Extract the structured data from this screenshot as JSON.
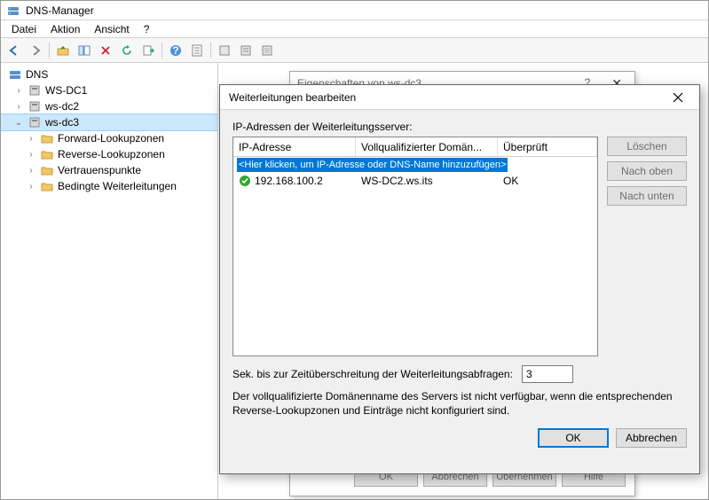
{
  "window": {
    "title": "DNS-Manager"
  },
  "menu": {
    "items": [
      "Datei",
      "Aktion",
      "Ansicht",
      "?"
    ]
  },
  "tree": {
    "root": "DNS",
    "servers": [
      "WS-DC1",
      "ws-dc2",
      "ws-dc3"
    ],
    "wsdc3_children": [
      "Forward-Lookupzonen",
      "Reverse-Lookupzonen",
      "Vertrauenspunkte",
      "Bedingte Weiterleitungen"
    ]
  },
  "bgDialog": {
    "title": "Eigenschaften von ws-dc3",
    "buttons": [
      "OK",
      "Abbrechen",
      "Übernehmen",
      "Hilfe"
    ]
  },
  "fgDialog": {
    "title": "Weiterleitungen bearbeiten",
    "listLabel": "IP-Adressen der Weiterleitungsserver:",
    "cols": {
      "ip": "IP-Adresse",
      "fqdn": "Vollqualifizierter Domän...",
      "ok": "Überprüft"
    },
    "hint": "<Hier klicken, um IP-Adresse oder DNS-Name hinzuzufügen>",
    "rows": [
      {
        "ip": "192.168.100.2",
        "fqdn": "WS-DC2.ws.its",
        "ok": "OK"
      }
    ],
    "side": {
      "delete": "Löschen",
      "up": "Nach oben",
      "down": "Nach unten"
    },
    "timeoutLabel": "Sek. bis zur Zeitüberschreitung der Weiterleitungsabfragen:",
    "timeoutValue": "3",
    "note": "Der vollqualifizierte Domänenname des Servers ist nicht verfügbar, wenn die entsprechenden Reverse-Lookupzonen und Einträge nicht konfiguriert sind.",
    "ok": "OK",
    "cancel": "Abbrechen"
  }
}
